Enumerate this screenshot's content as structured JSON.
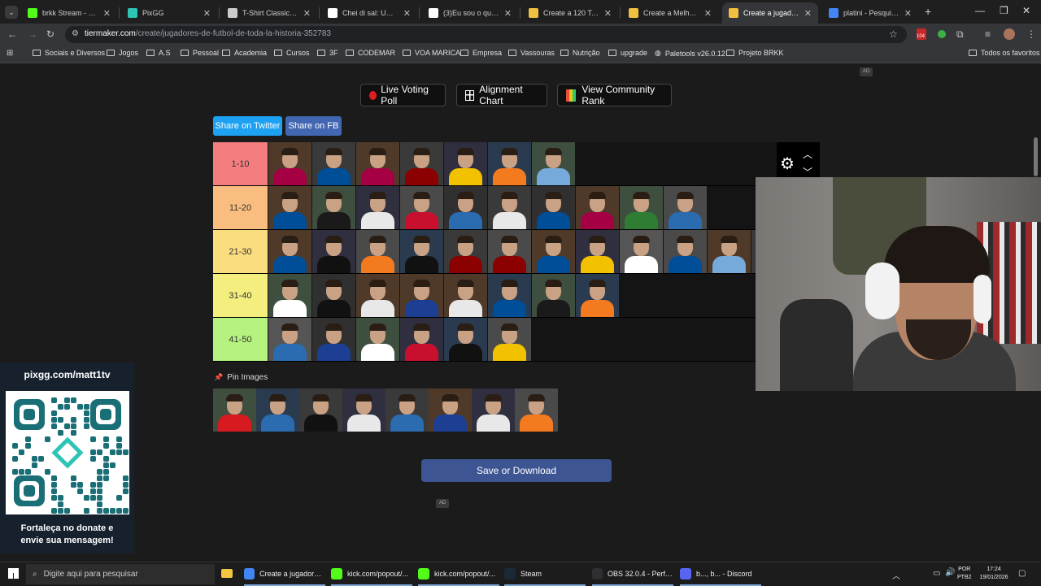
{
  "browser": {
    "tabs": [
      {
        "title": "brkk Stream - Watch",
        "icon": "kick-icon",
        "color": "#53fc18",
        "active": false
      },
      {
        "title": "PixGG",
        "icon": "pixgg-icon",
        "color": "#2ec4b6",
        "active": false
      },
      {
        "title": "T-Shirt Classic Vectra",
        "icon": "generic-icon",
        "color": "#cccccc",
        "active": false
      },
      {
        "title": "Chei di sal: Um Mem",
        "icon": "tiktok-icon",
        "color": "#ffffff",
        "active": false
      },
      {
        "title": "(3)Eu sou o que desn",
        "icon": "tiktok-icon",
        "color": "#ffffff",
        "active": false
      },
      {
        "title": "Create a 120 Top One",
        "icon": "tiermaker-icon",
        "color": "#f0c040",
        "active": false
      },
      {
        "title": "Create a Melhores lu",
        "icon": "tiermaker-icon",
        "color": "#f0c040",
        "active": false
      },
      {
        "title": "Create a jugadores de",
        "icon": "tiermaker-icon",
        "color": "#f0c040",
        "active": true
      },
      {
        "title": "platini - Pesquisa Go",
        "icon": "google-icon",
        "color": "#4285f4",
        "active": false
      }
    ],
    "url_domain": "tiermaker.com",
    "url_path": "/create/jugadores-de-futbol-de-toda-la-historia-352783",
    "extension_badge": "104",
    "bookmarks": [
      {
        "label": "Sociais e Diversos",
        "type": "folder"
      },
      {
        "label": "Jogos",
        "type": "folder"
      },
      {
        "label": "A.S",
        "type": "folder"
      },
      {
        "label": "Pessoal",
        "type": "folder"
      },
      {
        "label": "Academia",
        "type": "folder"
      },
      {
        "label": "Cursos",
        "type": "folder"
      },
      {
        "label": "3F",
        "type": "folder"
      },
      {
        "label": "CODEMAR",
        "type": "folder"
      },
      {
        "label": "VOA MARICA",
        "type": "folder"
      },
      {
        "label": "Empresa",
        "type": "folder"
      },
      {
        "label": "Vassouras",
        "type": "folder"
      },
      {
        "label": "Nutrição",
        "type": "folder"
      },
      {
        "label": "upgrade",
        "type": "folder"
      },
      {
        "label": "Paletools v26.0.12",
        "type": "site"
      },
      {
        "label": "Projeto BRKK",
        "type": "folder"
      }
    ],
    "all_favorites": "Todos os favoritos"
  },
  "page": {
    "ad_label": "AD",
    "buttons": {
      "live_voting": "Live Voting Poll",
      "alignment": "Alignment Chart",
      "community": "View Community Rank"
    },
    "share_twitter": "Share on Twitter",
    "share_fb": "Share on FB",
    "tiers": [
      {
        "label": "1-10",
        "color": "#f47e7f",
        "count": 7
      },
      {
        "label": "11-20",
        "color": "#f9be7f",
        "count": 10
      },
      {
        "label": "21-30",
        "color": "#fadd7f",
        "count": 12
      },
      {
        "label": "31-40",
        "color": "#f4ee7f",
        "count": 8
      },
      {
        "label": "41-50",
        "color": "#b5f27f",
        "count": 6
      }
    ],
    "pin_images": "Pin Images",
    "pool_count": 8,
    "save_button": "Save or Download"
  },
  "overlay": {
    "pix_url": "pixgg.com/matt1tv",
    "pix_message_line1": "Fortaleça no donate e",
    "pix_message_line2": "envie sua mensagem!"
  },
  "taskbar": {
    "search_placeholder": "Digite aqui para pesquisar",
    "items": [
      {
        "label": "Create a jugadores ...",
        "icon": "chrome-icon",
        "color": "#4285f4"
      },
      {
        "label": "kick.com/popout/...",
        "icon": "kick-icon",
        "color": "#53fc18"
      },
      {
        "label": "kick.com/popout/...",
        "icon": "kick-icon",
        "color": "#53fc18"
      },
      {
        "label": "Steam",
        "icon": "steam-icon",
        "color": "#1b2838"
      },
      {
        "label": "OBS 32.0.4 - Perfil: ...",
        "icon": "obs-icon",
        "color": "#302e31"
      },
      {
        "label": "b..., b... - Discord",
        "icon": "discord-icon",
        "color": "#5865f2"
      }
    ],
    "lang_line1": "POR",
    "lang_line2": "PTB2",
    "time": "17:24",
    "date": "19/01/2026"
  }
}
